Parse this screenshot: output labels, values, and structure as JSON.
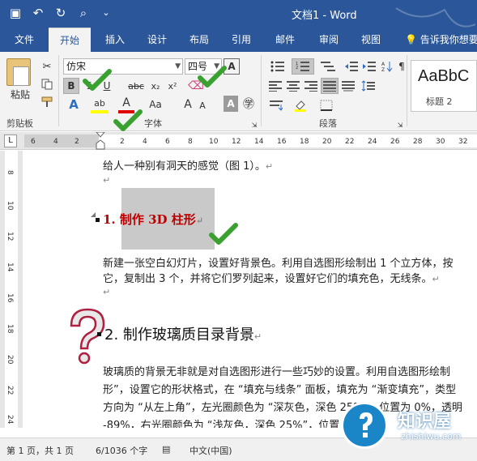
{
  "window": {
    "title": "文档1  -  Word"
  },
  "qat": {
    "save_glyph": "▣",
    "undo_glyph": "↶",
    "redo_glyph": "↻",
    "preview_glyph": "⌕",
    "more_glyph": "⌄"
  },
  "tabs": [
    {
      "label": "文件"
    },
    {
      "label": "开始"
    },
    {
      "label": "插入"
    },
    {
      "label": "设计"
    },
    {
      "label": "布局"
    },
    {
      "label": "引用"
    },
    {
      "label": "邮件"
    },
    {
      "label": "审阅"
    },
    {
      "label": "视图"
    }
  ],
  "tell_me": "告诉我你想要",
  "ribbon": {
    "paste_label": "粘贴",
    "clipboard_group": "剪贴板",
    "font_group": "字体",
    "paragraph_group": "段落",
    "font_name": "仿宋",
    "font_size": "四号",
    "bold": "B",
    "italic": "I",
    "underline": "U",
    "strike": "abc",
    "subscript": "x₂",
    "superscript": "x²",
    "char_border": "A",
    "grow": "A",
    "shrink": "A",
    "change_case": "Aa",
    "text_effects": "A",
    "highlight": "ab",
    "font_color": "A",
    "char_shading": "A",
    "enclose": "㊫",
    "phonetic": "文",
    "styles_sample": "AaBbC",
    "styles_name": "标题 2"
  },
  "ruler": {
    "h_numbers": [
      "6",
      "4",
      "2",
      "2",
      "4",
      "6",
      "8",
      "10",
      "12",
      "14",
      "16",
      "18",
      "20",
      "22",
      "24",
      "26",
      "28",
      "30",
      "32"
    ],
    "tab_glyph": "L"
  },
  "vruler": {
    "numbers": [
      "8",
      "10",
      "12",
      "14",
      "16",
      "18",
      "20",
      "22",
      "24"
    ]
  },
  "document": {
    "line1": "给人一种别有洞天的感觉（图 1）。",
    "pm": "↵",
    "heading1": "1.  制作 3D 柱形",
    "para1_l1": "新建一张空白幻灯片，设置好背景色。利用自选图形绘制出 1 个立方体，按",
    "para1_l2": "它，复制出 3 个，并将它们罗列起来，设置好它们的填充色，无线条。",
    "heading2": "2.  制作玻璃质目录背景",
    "para2_l1": "玻璃质的背景无非就是对自选图形进行一些巧妙的设置。利用自选图形绘制",
    "para2_l2": "形”，设置它的形状格式，在 “填充与线条” 面板，填充为 “渐变填充”，类型",
    "para2_l3": "方向为 “从左上角”，左光圈颜色为 “深灰色，深色 25%”，位置为 0%，透明",
    "para2_l4": "-89%，右光圈颜色为 “浅灰色，深色 25%”，位置"
  },
  "status": {
    "page": "第 1 页，共 1 页",
    "words": "6/1036 个字",
    "lang": "中文(中国)"
  },
  "watermark": {
    "name": "知识屋",
    "url": "zhishiwu.com"
  },
  "colors": {
    "accent": "#2b579a",
    "heading_red": "#c00000",
    "check_green": "#3aa030"
  }
}
